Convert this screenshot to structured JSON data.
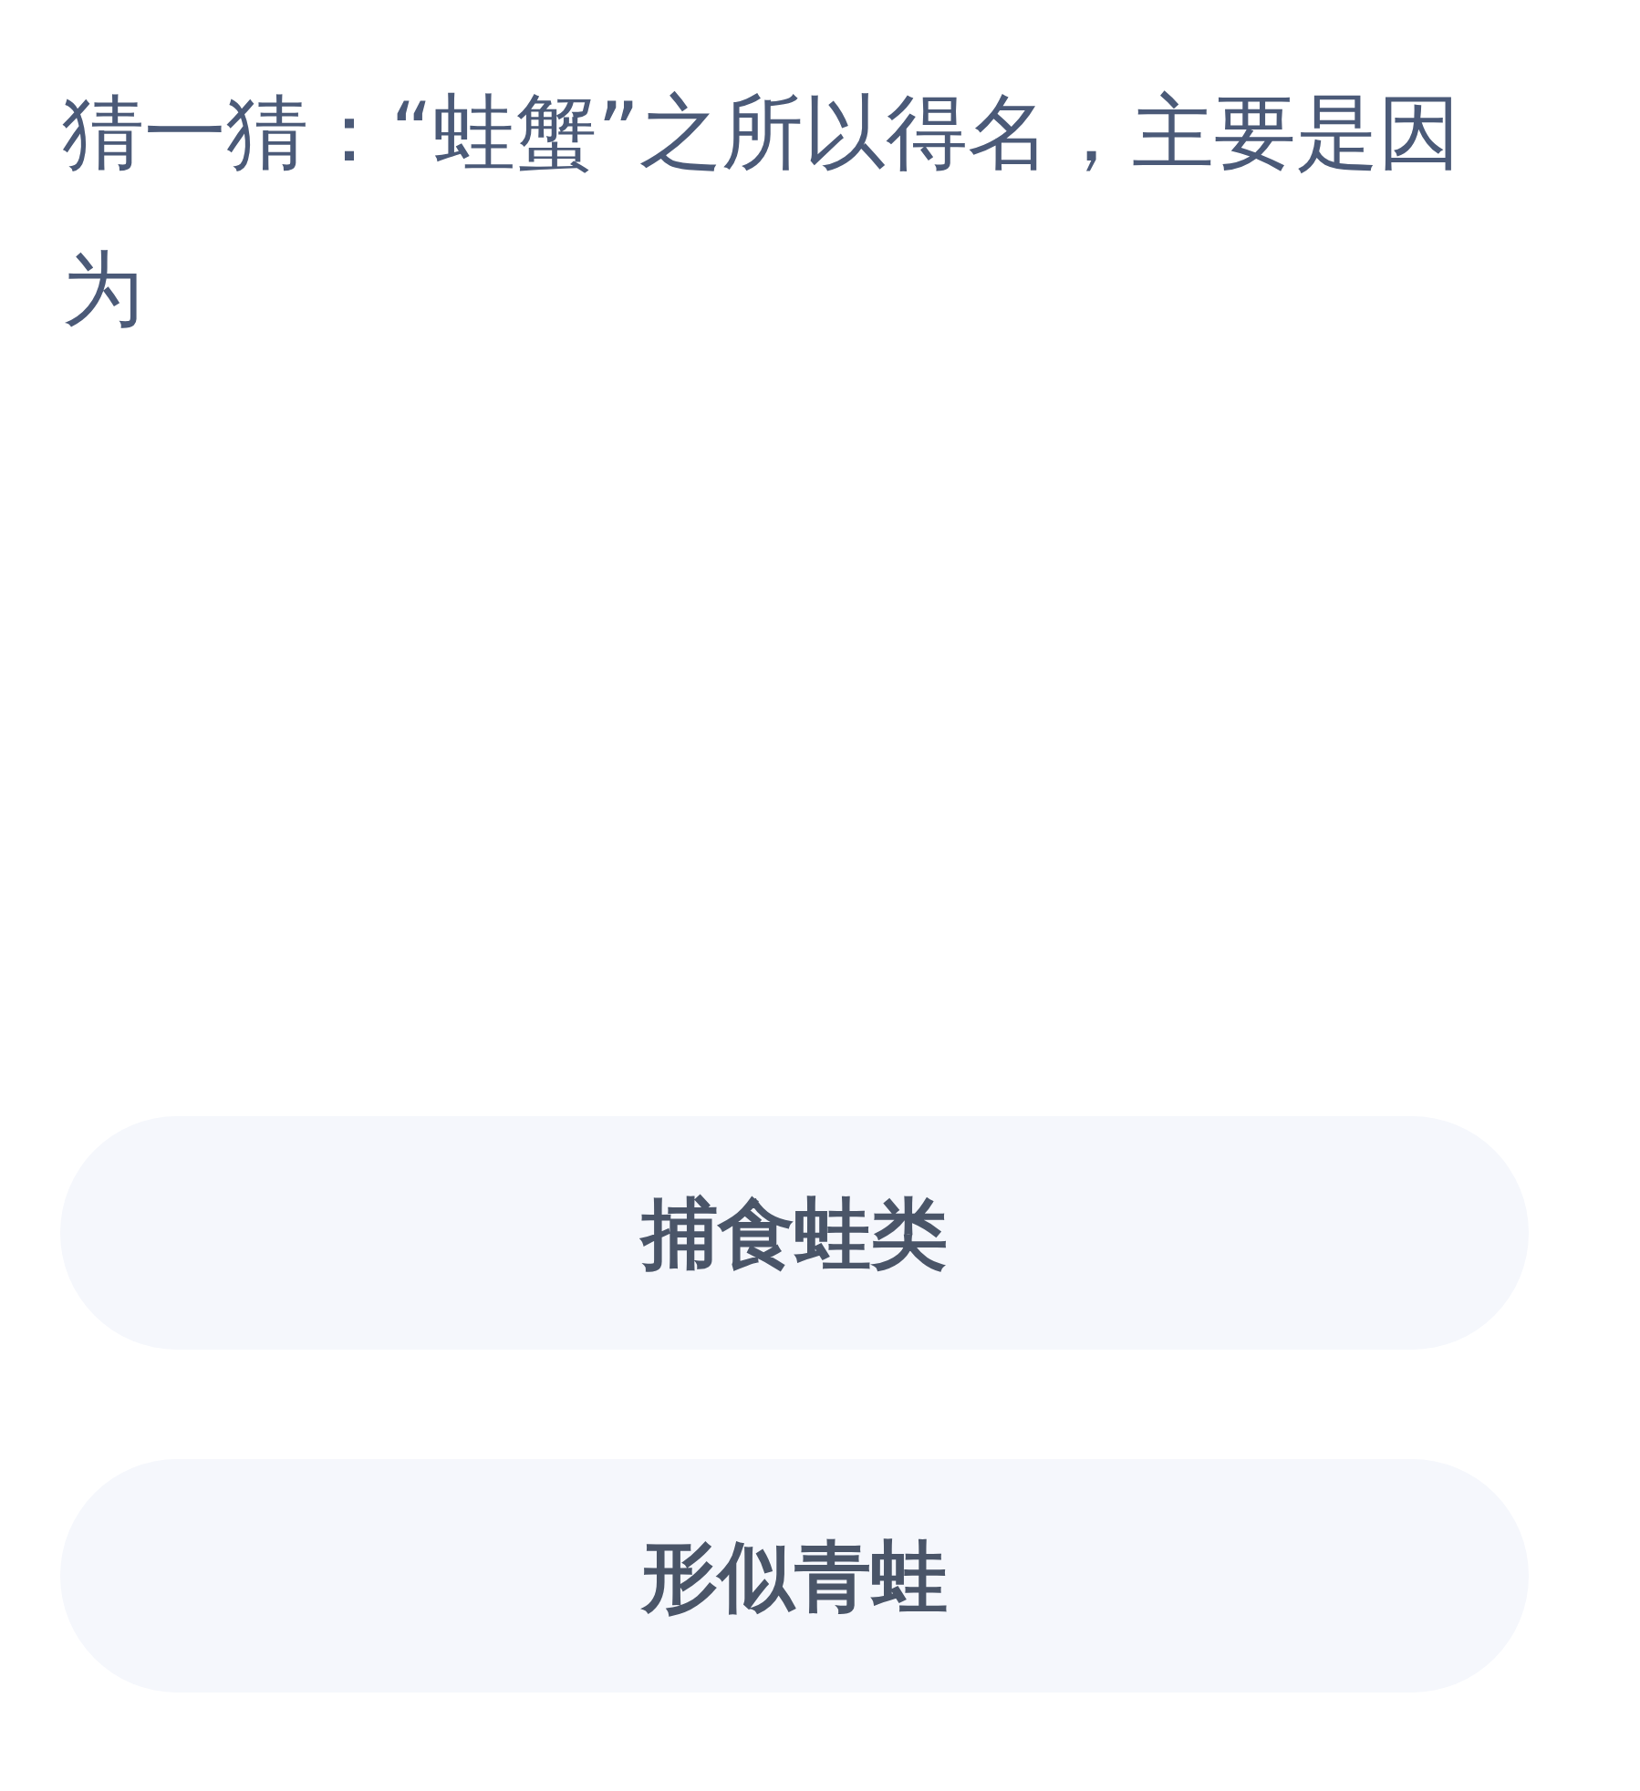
{
  "question": "猜一猜：“蛙蟹”之所以得名，主要是因为",
  "options": [
    {
      "label": "捕食蛙类"
    },
    {
      "label": "形似青蛙"
    }
  ]
}
